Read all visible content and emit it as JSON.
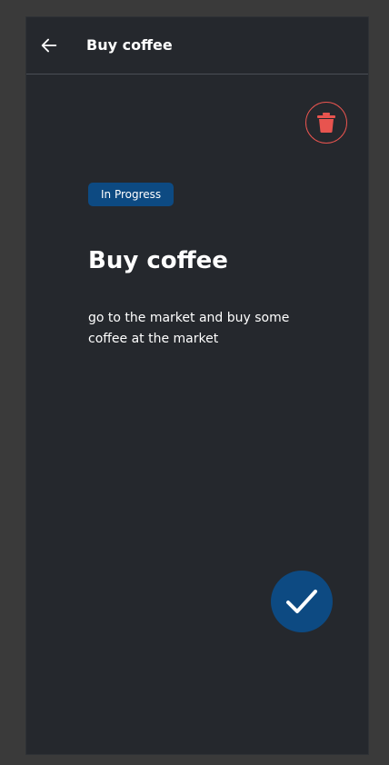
{
  "appbar": {
    "title": "Buy coffee",
    "back_icon": "arrow-left-icon"
  },
  "task": {
    "status": "In Progress",
    "title": "Buy coffee",
    "description": "go to the market and buy some coffee at the market"
  },
  "actions": {
    "delete_icon": "trash-icon",
    "complete_icon": "checkmark-icon"
  },
  "colors": {
    "background": "#25282d",
    "accent": "#0d4a82",
    "danger": "#e8544f"
  }
}
